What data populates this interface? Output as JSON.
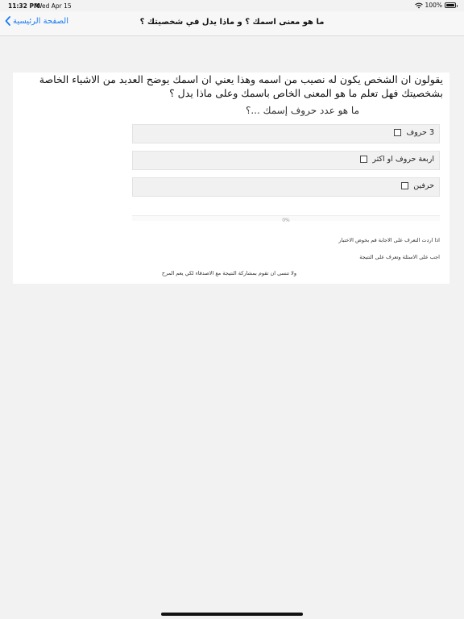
{
  "status_bar": {
    "time": "11:32 PM",
    "date": "Wed Apr 15",
    "battery": "100%",
    "battery_level": 1.0,
    "wifi_icon": "wifi-icon"
  },
  "nav": {
    "back_label": "الصفحة الرئيسية",
    "title": "ما هو معنى اسمك ؟ و ماذا يدل في شخصيتك ؟"
  },
  "content": {
    "intro": "يقولون ان الشخص يكون له نصيب من اسمه وهذا يعني ان اسمك يوضح العديد من الاشياء الخاصة بشخصيتك فهل تعلم ما هو المعنى الخاص باسمك وعلى ماذا يدل ؟",
    "question": "ما هو عدد حروف إسمك ...؟",
    "options": [
      {
        "label": "3 حروف",
        "checked": false
      },
      {
        "label": "اربعة حروف او اكثر",
        "checked": false
      },
      {
        "label": "حرفين",
        "checked": false
      }
    ],
    "progress_label": "0%",
    "progress_value": 0,
    "notes": [
      "اذا اردت التعرف على الاجابة قم بخوض الاختبار",
      "اجب على الاسئلة وتعرف على النتيجة",
      "ولا تنسى ان تقوم بمشاركة النتيجة مع الاصدقاء لكي يعم المرح"
    ]
  },
  "colors": {
    "accent": "#1a7cf5",
    "background": "#f2f2f2",
    "card": "#ffffff",
    "option_bg": "#f1f1f1"
  }
}
